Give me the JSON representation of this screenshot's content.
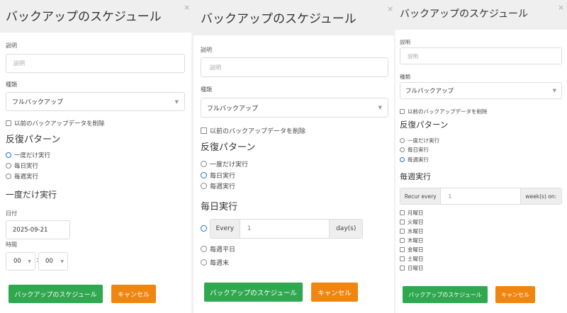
{
  "panel1": {
    "title": "バックアップのスケジュール",
    "close": "×",
    "description_label": "説明",
    "description_placeholder": "説明",
    "type_label": "種類",
    "type_value": "フルバックアップ",
    "delete_previous": "以前のバックアップデータを削除",
    "pattern_heading": "反復パターン",
    "options": [
      "一度だけ実行",
      "毎日実行",
      "毎週実行"
    ],
    "section_heading": "一度だけ実行",
    "date_label": "日付",
    "date_value": "2025-09-21",
    "time_label": "時間",
    "hour_value": "00",
    "time_sep": ":",
    "minute_value": "00",
    "submit": "バックアップのスケジュール",
    "cancel": "キャンセル"
  },
  "panel2": {
    "title": "バックアップのスケジュール",
    "close": "×",
    "description_label": "説明",
    "description_placeholder": "説明",
    "type_label": "種類",
    "type_value": "フルバックアップ",
    "delete_previous": "以前のバックアップデータを削除",
    "pattern_heading": "反復パターン",
    "options": [
      "一度だけ実行",
      "毎日実行",
      "毎週実行"
    ],
    "section_heading": "毎日実行",
    "every_label": "Every",
    "every_value": "1",
    "every_unit": "day(s)",
    "weekday_option": "毎週平日",
    "weekend_option": "毎週末",
    "submit": "バックアップのスケジュール",
    "cancel": "キャンセル"
  },
  "panel3": {
    "title": "バックアップのスケジュール",
    "close": "×",
    "description_label": "説明",
    "description_placeholder": "説明",
    "type_label": "種類",
    "type_value": "フルバックアップ",
    "delete_previous": "以前のバックアップデータを削除",
    "pattern_heading": "反復パターン",
    "options": [
      "一度だけ実行",
      "毎日実行",
      "毎週実行"
    ],
    "section_heading": "毎週実行",
    "recur_label": "Recur every",
    "recur_value": "1",
    "recur_unit": "week(s) on:",
    "days": [
      "月曜日",
      "火曜日",
      "水曜日",
      "木曜日",
      "金曜日",
      "土曜日",
      "日曜日"
    ],
    "submit": "バックアップのスケジュール",
    "cancel": "キャンセル"
  },
  "colors": {
    "primary": "#2fa84f",
    "cancel": "#f0860f",
    "radio_selected": "#1b6fd6",
    "header_bg": "#efefef"
  }
}
